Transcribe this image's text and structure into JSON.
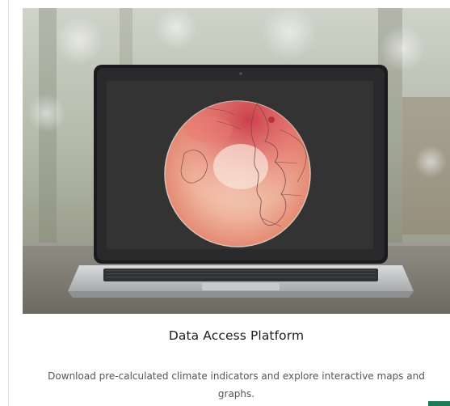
{
  "card": {
    "title": "Data Access Platform",
    "description": "Download pre-calculated climate indicators and explore interactive maps and graphs."
  },
  "hero": {
    "image": "laptop-displaying-climate-globe-map"
  },
  "colors": {
    "accent": "#1f7a5a",
    "title_text": "#1e1e1e",
    "body_text": "#555555"
  }
}
